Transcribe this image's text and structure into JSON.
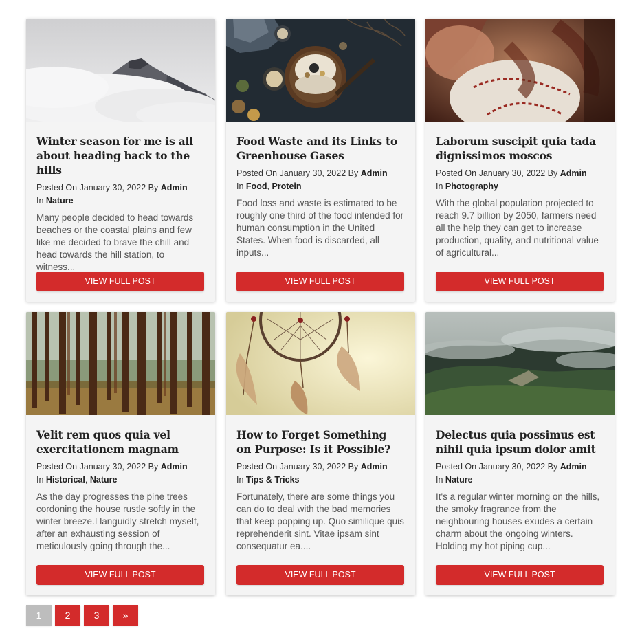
{
  "posts": [
    {
      "title": "Winter season for me is all about heading back to the hills",
      "posted_prefix": "Posted On",
      "date": "January 30, 2022",
      "by_label": "By",
      "author": "Admin",
      "in_label": "In",
      "categories": [
        "Nature"
      ],
      "excerpt": "Many people decided to head towards beaches or the coastal plains and few like me decided to brave the chill and head towards the hill station, to witness...",
      "button": "View Full Post",
      "image": "misty-mountain"
    },
    {
      "title": "Food Waste and its Links to Greenhouse Gases",
      "posted_prefix": "Posted On",
      "date": "January 30, 2022",
      "by_label": "By",
      "author": "Admin",
      "in_label": "In",
      "categories": [
        "Food",
        "Protein"
      ],
      "excerpt": "Food loss and waste is estimated to be roughly one third of the food intended for human consumption in the United States. When food is discarded, all inputs...",
      "button": "View Full Post",
      "image": "dark-table-food"
    },
    {
      "title": "Laborum suscipit quia tada dignissimos moscos",
      "posted_prefix": "Posted On",
      "date": "January 30, 2022",
      "by_label": "By",
      "author": "Admin",
      "in_label": "In",
      "categories": [
        "Photography"
      ],
      "excerpt": "With the global population projected to reach 9.7 billion by 2050, farmers need all the help they can get to increase production, quality, and nutritional value of agricultural...",
      "button": "View Full Post",
      "image": "baseball-glove"
    },
    {
      "title": "Velit rem quos quia vel exercitationem magnam",
      "posted_prefix": "Posted On",
      "date": "January 30, 2022",
      "by_label": "By",
      "author": "Admin",
      "in_label": "In",
      "categories": [
        "Historical",
        "Nature"
      ],
      "excerpt": "As the day progresses the pine trees cordoning the house rustle softly in the winter breeze.I languidly stretch myself, after an exhausting session of meticulously going through the...",
      "button": "View Full Post",
      "image": "pine-forest"
    },
    {
      "title": "How to Forget Something on Purpose: Is it Possible?",
      "posted_prefix": "Posted On",
      "date": "January 30, 2022",
      "by_label": "By",
      "author": "Admin",
      "in_label": "In",
      "categories": [
        "Tips & Tricks"
      ],
      "excerpt": "Fortunately, there are some things you can do to deal with the bad memories that keep popping up. Quo similique quis reprehenderit sint. Vitae ipsam sint consequatur ea....",
      "button": "View Full Post",
      "image": "dreamcatcher"
    },
    {
      "title": "Delectus quia possimus est nihil quia ipsum dolor amit",
      "posted_prefix": "Posted On",
      "date": "January 30, 2022",
      "by_label": "By",
      "author": "Admin",
      "in_label": "In",
      "categories": [
        "Nature"
      ],
      "excerpt": "It's a regular winter morning on the hills, the smoky fragrance from the neighbouring houses exudes a certain charm about the ongoing winters. Holding my hot piping cup...",
      "button": "View Full Post",
      "image": "foggy-green-hills"
    }
  ],
  "pagination": {
    "pages": [
      "1",
      "2",
      "3"
    ],
    "current": "1",
    "next": "»"
  },
  "colors": {
    "accent": "#d32b2b",
    "card_bg": "#f4f4f4",
    "pager_current": "#bdbdbd"
  }
}
